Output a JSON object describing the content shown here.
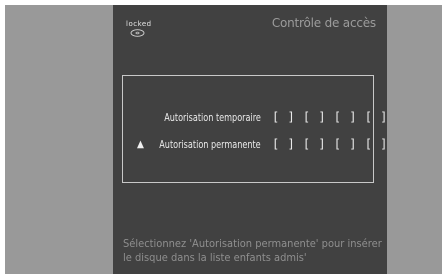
{
  "status": {
    "locked_label": "locked",
    "disc_icon": "disc-icon"
  },
  "header": {
    "title": "Contrôle de accès"
  },
  "menu": {
    "items": [
      {
        "label": "Autorisation temporaire",
        "value": "[ ] [ ] [ ] [ ]",
        "selected": false
      },
      {
        "label": "Autorisation permanente",
        "value": "[ ] [ ] [ ] [ ]",
        "selected": true
      }
    ],
    "pointer_glyph": "▲"
  },
  "hint": {
    "line1": "Sélectionnez 'Autorisation permanente' pour insérer",
    "line2": "le disque dans la liste enfants admis'"
  },
  "colors": {
    "screen_bg": "#414141",
    "backdrop": "#999999",
    "dialog_border": "#c8c8c8",
    "title_text": "#9c9c9c",
    "hint_text": "#8f8f8f"
  }
}
